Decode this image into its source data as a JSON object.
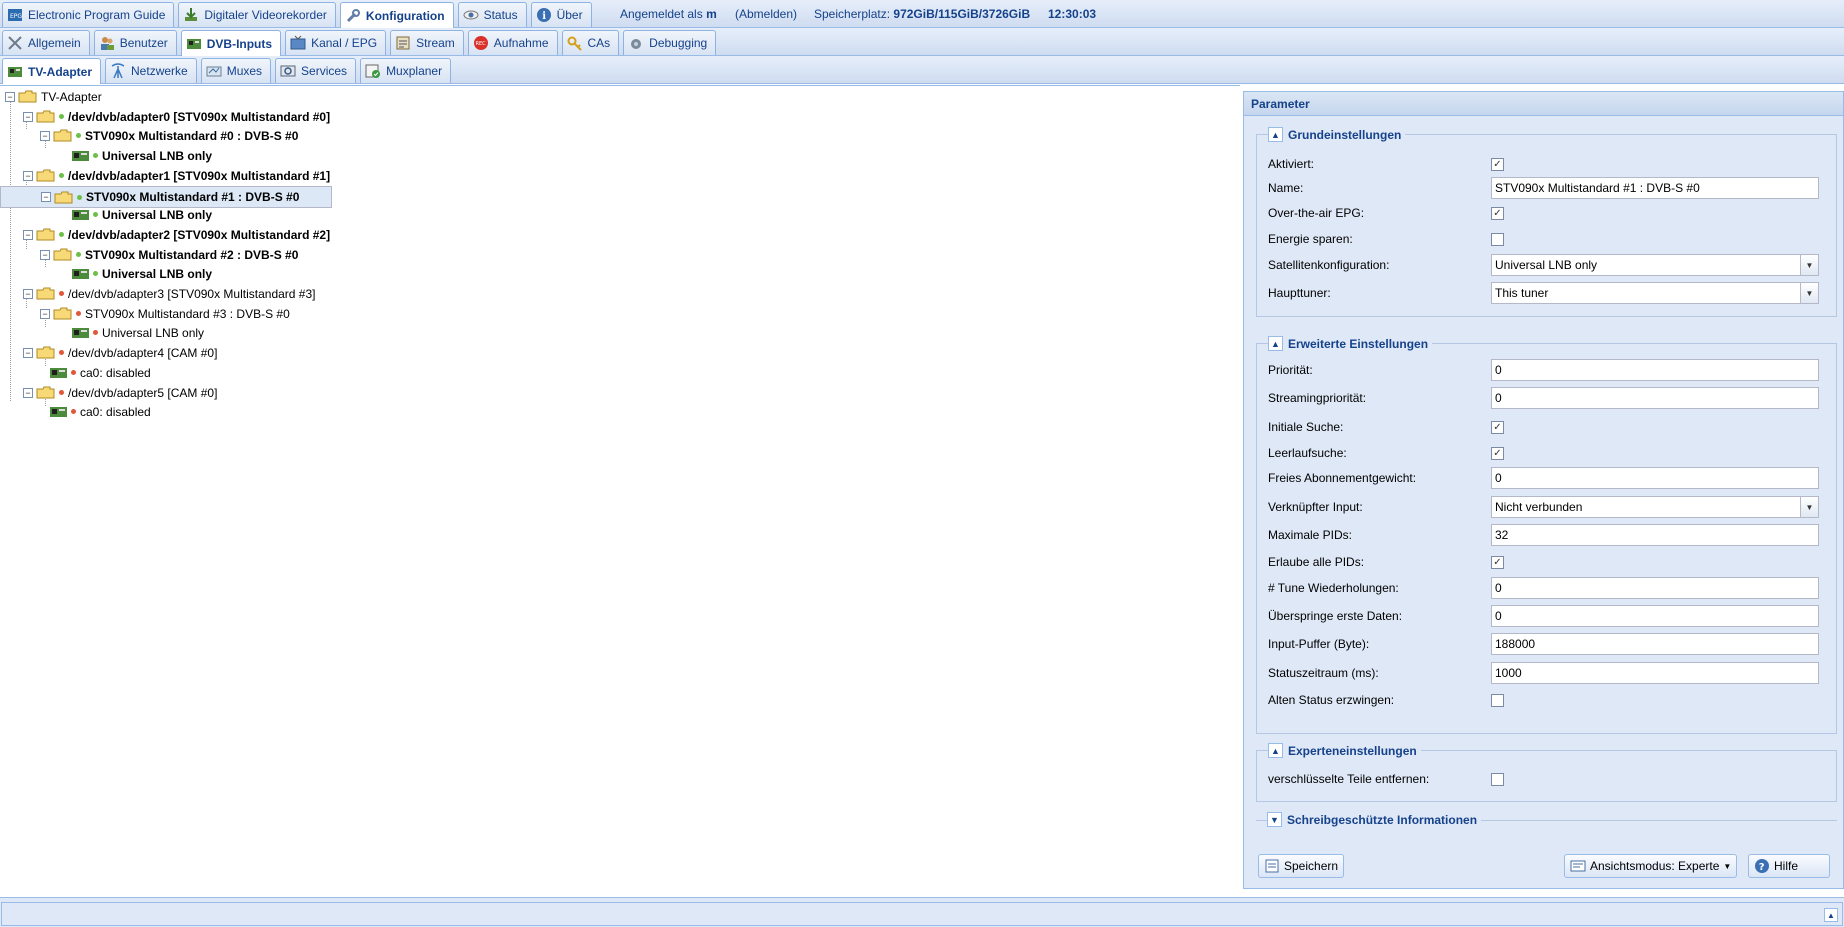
{
  "top_tabs": [
    {
      "label": "Electronic Program Guide",
      "icon": "epg-icon"
    },
    {
      "label": "Digitaler Videorekorder",
      "icon": "download-icon"
    },
    {
      "label": "Konfiguration",
      "icon": "wrench-icon"
    },
    {
      "label": "Status",
      "icon": "eye-icon"
    },
    {
      "label": "Über",
      "icon": "info-icon"
    }
  ],
  "top_info": {
    "logged_in_prefix": "Angemeldet als",
    "user": "m",
    "logout": "(Abmelden)",
    "storage_label": "Speicherplatz:",
    "storage_value": "972GiB/115GiB/3726GiB",
    "time": "12:30:03"
  },
  "config_tabs": [
    {
      "label": "Allgemein",
      "icon": "tools-icon"
    },
    {
      "label": "Benutzer",
      "icon": "users-icon"
    },
    {
      "label": "DVB-Inputs",
      "icon": "tv-card-icon"
    },
    {
      "label": "Kanal / EPG",
      "icon": "tv-icon"
    },
    {
      "label": "Stream",
      "icon": "stream-icon"
    },
    {
      "label": "Aufnahme",
      "icon": "record-icon"
    },
    {
      "label": "CAs",
      "icon": "key-icon"
    },
    {
      "label": "Debugging",
      "icon": "bug-icon"
    }
  ],
  "dvb_tabs": [
    {
      "label": "TV-Adapter",
      "icon": "tv-card-icon"
    },
    {
      "label": "Netzwerke",
      "icon": "antenna-icon"
    },
    {
      "label": "Muxes",
      "icon": "mux-icon"
    },
    {
      "label": "Services",
      "icon": "services-icon"
    },
    {
      "label": "Muxplaner",
      "icon": "scheduler-icon"
    }
  ],
  "tree": [
    {
      "label": "TV-Adapter",
      "level": 0,
      "kind": "root"
    },
    {
      "label": "/dev/dvb/adapter0 [STV090x Multistandard #0]",
      "level": 1,
      "kind": "folder",
      "status": "green",
      "bold": true
    },
    {
      "label": "STV090x Multistandard #0 : DVB-S #0",
      "level": 2,
      "kind": "folder",
      "status": "green",
      "bold": true
    },
    {
      "label": "Universal LNB only",
      "level": 3,
      "kind": "card",
      "status": "green",
      "bold": true
    },
    {
      "label": "/dev/dvb/adapter1 [STV090x Multistandard #1]",
      "level": 1,
      "kind": "folder",
      "status": "green",
      "bold": true
    },
    {
      "label": "STV090x Multistandard #1 : DVB-S #0",
      "level": 2,
      "kind": "folder",
      "status": "green",
      "bold": true,
      "selected": true
    },
    {
      "label": "Universal LNB only",
      "level": 3,
      "kind": "card",
      "status": "green",
      "bold": true
    },
    {
      "label": "/dev/dvb/adapter2 [STV090x Multistandard #2]",
      "level": 1,
      "kind": "folder",
      "status": "green",
      "bold": true
    },
    {
      "label": "STV090x Multistandard #2 : DVB-S #0",
      "level": 2,
      "kind": "folder",
      "status": "green",
      "bold": true
    },
    {
      "label": "Universal LNB only",
      "level": 3,
      "kind": "card",
      "status": "green",
      "bold": true
    },
    {
      "label": "/dev/dvb/adapter3 [STV090x Multistandard #3]",
      "level": 1,
      "kind": "folder",
      "status": "red",
      "bold": false
    },
    {
      "label": "STV090x Multistandard #3 : DVB-S #0",
      "level": 2,
      "kind": "folder",
      "status": "red",
      "bold": false
    },
    {
      "label": "Universal LNB only",
      "level": 3,
      "kind": "card",
      "status": "red",
      "bold": false
    },
    {
      "label": "/dev/dvb/adapter4 [CAM #0]",
      "level": 1,
      "kind": "folder",
      "status": "red",
      "bold": false
    },
    {
      "label": "ca0: disabled",
      "level": 2,
      "kind": "card",
      "status": "red",
      "bold": false
    },
    {
      "label": "/dev/dvb/adapter5 [CAM #0]",
      "level": 1,
      "kind": "folder",
      "status": "red",
      "bold": false
    },
    {
      "label": "ca0: disabled",
      "level": 2,
      "kind": "card",
      "status": "red",
      "bold": false
    }
  ],
  "panel": {
    "title": "Parameter",
    "grund": {
      "legend": "Grundeinstellungen",
      "aktiviert": {
        "label": "Aktiviert:",
        "checked": true
      },
      "name": {
        "label": "Name:",
        "value": "STV090x Multistandard #1 : DVB-S #0"
      },
      "epg": {
        "label": "Over-the-air EPG:",
        "checked": true
      },
      "energie": {
        "label": "Energie sparen:",
        "checked": false
      },
      "satkonf": {
        "label": "Satellitenkonfiguration:",
        "value": "Universal LNB only"
      },
      "haupttuner": {
        "label": "Haupttuner:",
        "value": "This tuner"
      }
    },
    "erweitert": {
      "legend": "Erweiterte Einstellungen",
      "prio": {
        "label": "Priorität:",
        "value": "0"
      },
      "streamprio": {
        "label": "Streamingpriorität:",
        "value": "0"
      },
      "initsuche": {
        "label": "Initiale Suche:",
        "checked": true
      },
      "leerlauf": {
        "label": "Leerlaufsuche:",
        "checked": true
      },
      "abo": {
        "label": "Freies Abonnementgewicht:",
        "value": "0"
      },
      "verknuepft": {
        "label": "Verknüpfter Input:",
        "value": "Nicht verbunden"
      },
      "maxpids": {
        "label": "Maximale PIDs:",
        "value": "32"
      },
      "allepids": {
        "label": "Erlaube alle PIDs:",
        "checked": true
      },
      "tunewdh": {
        "label": "# Tune Wiederholungen:",
        "value": "0"
      },
      "ueberspringe": {
        "label": "Überspringe erste Daten:",
        "value": "0"
      },
      "puffer": {
        "label": "Input-Puffer (Byte):",
        "value": "188000"
      },
      "statuszeit": {
        "label": "Statuszeitraum (ms):",
        "value": "1000"
      },
      "altstatus": {
        "label": "Alten Status erzwingen:",
        "checked": false
      }
    },
    "experten": {
      "legend": "Experteneinstellungen",
      "verschl": {
        "label": "verschlüsselte Teile entfernen:",
        "checked": false
      }
    },
    "readonly": {
      "legend": "Schreibgeschützte Informationen"
    },
    "save_label": "Speichern",
    "view_mode_label": "Ansichtsmodus: Experte",
    "help_label": "Hilfe"
  }
}
